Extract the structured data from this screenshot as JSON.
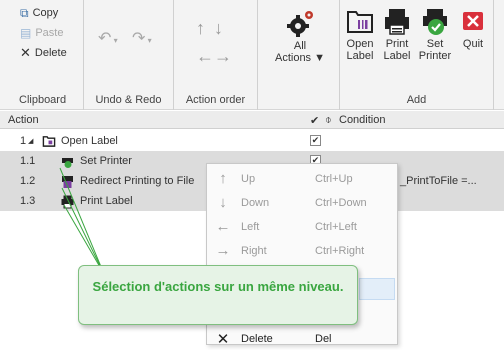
{
  "ribbon": {
    "clipboard": {
      "copy": "Copy",
      "paste": "Paste",
      "delete": "Delete",
      "label": "Clipboard"
    },
    "undo_redo": {
      "label": "Undo & Redo"
    },
    "action_order": {
      "label": "Action order"
    },
    "all_actions": {
      "line1": "All",
      "line2": "Actions ▼"
    },
    "add": {
      "label": "Add",
      "open_label": {
        "line1": "Open",
        "line2": "Label"
      },
      "print_label": {
        "line1": "Print",
        "line2": "Label"
      },
      "set_printer": {
        "line1": "Set",
        "line2": "Printer"
      },
      "quit": "Quit"
    }
  },
  "header": {
    "action": "Action",
    "check": "✔",
    "condition": "Condition",
    "condition_icon": "⌽"
  },
  "rows": [
    {
      "num": "1",
      "toggle": "◢",
      "name": "Open Label",
      "check": "✔"
    },
    {
      "num": "1.1",
      "name": "Set Printer",
      "check": "✔"
    },
    {
      "num": "1.2",
      "name": "Redirect Printing to File",
      "condition": "_PrintToFile =..."
    },
    {
      "num": "1.3",
      "name": "Print Label"
    }
  ],
  "menu": [
    {
      "label": "Up",
      "shortcut": "Ctrl+Up",
      "icon": "↑"
    },
    {
      "label": "Down",
      "shortcut": "Ctrl+Down",
      "icon": "↓"
    },
    {
      "label": "Left",
      "shortcut": "Ctrl+Left",
      "icon": "←"
    },
    {
      "label": "Right",
      "shortcut": "Ctrl+Right",
      "icon": "→"
    },
    {
      "label": "Delete",
      "shortcut": "Del",
      "icon": "✕"
    }
  ],
  "callout": {
    "text": "Sélection d'actions sur un même niveau."
  },
  "colors": {
    "ribbon_bg": "#f3f3f3",
    "selection_bg": "#dcdcdc",
    "callout_green": "#3aa640",
    "quit_red": "#d9303c"
  }
}
